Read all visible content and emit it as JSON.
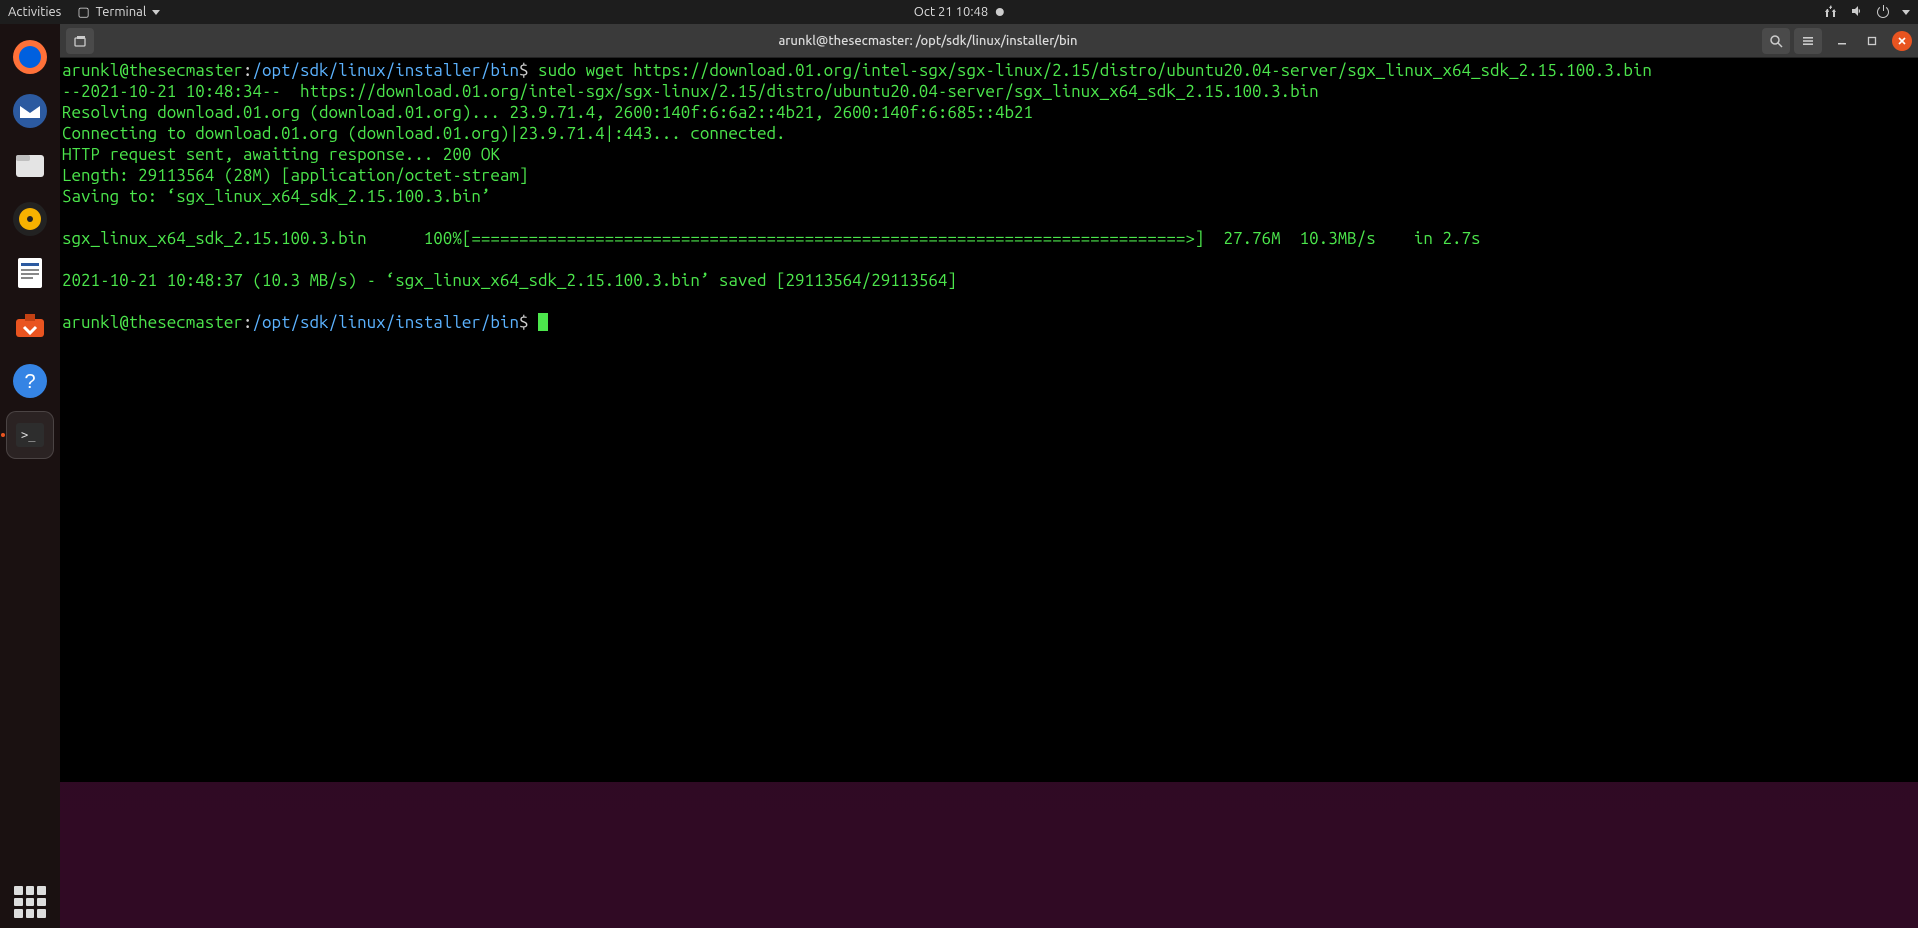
{
  "top_panel": {
    "activities": "Activities",
    "app_menu": "Terminal",
    "clock": "Oct 21  10:48"
  },
  "dock": {
    "items": [
      {
        "name": "firefox"
      },
      {
        "name": "thunderbird"
      },
      {
        "name": "files"
      },
      {
        "name": "rhythmbox"
      },
      {
        "name": "libreoffice-writer"
      },
      {
        "name": "ubuntu-software"
      },
      {
        "name": "help"
      },
      {
        "name": "terminal"
      }
    ]
  },
  "window": {
    "title": "arunkl@thesecmaster: /opt/sdk/linux/installer/bin"
  },
  "terminal": {
    "prompt_user": "arunkl@thesecmaster",
    "prompt_sep": ":",
    "prompt_path": "/opt/sdk/linux/installer/bin",
    "prompt_dollar": "$",
    "cmd1": "sudo wget https://download.01.org/intel-sgx/sgx-linux/2.15/distro/ubuntu20.04-server/sgx_linux_x64_sdk_2.15.100.3.bin",
    "out1": "--2021-10-21 10:48:34--  https://download.01.org/intel-sgx/sgx-linux/2.15/distro/ubuntu20.04-server/sgx_linux_x64_sdk_2.15.100.3.bin",
    "out2": "Resolving download.01.org (download.01.org)... 23.9.71.4, 2600:140f:6:6a2::4b21, 2600:140f:6:685::4b21",
    "out3": "Connecting to download.01.org (download.01.org)|23.9.71.4|:443... connected.",
    "out4": "HTTP request sent, awaiting response... 200 OK",
    "out5": "Length: 29113564 (28M) [application/octet-stream]",
    "out6": "Saving to: ‘sgx_linux_x64_sdk_2.15.100.3.bin’",
    "progress_name": "sgx_linux_x64_sdk_2.15.100.3.bin",
    "progress_pct": "100%",
    "progress_bar": "[===========================================================================>]",
    "progress_size": "27.76M",
    "progress_speed": "10.3MB/s",
    "progress_in": "in 2.7s",
    "out7": "2021-10-21 10:48:37 (10.3 MB/s) - ‘sgx_linux_x64_sdk_2.15.100.3.bin’ saved [29113564/29113564]"
  }
}
